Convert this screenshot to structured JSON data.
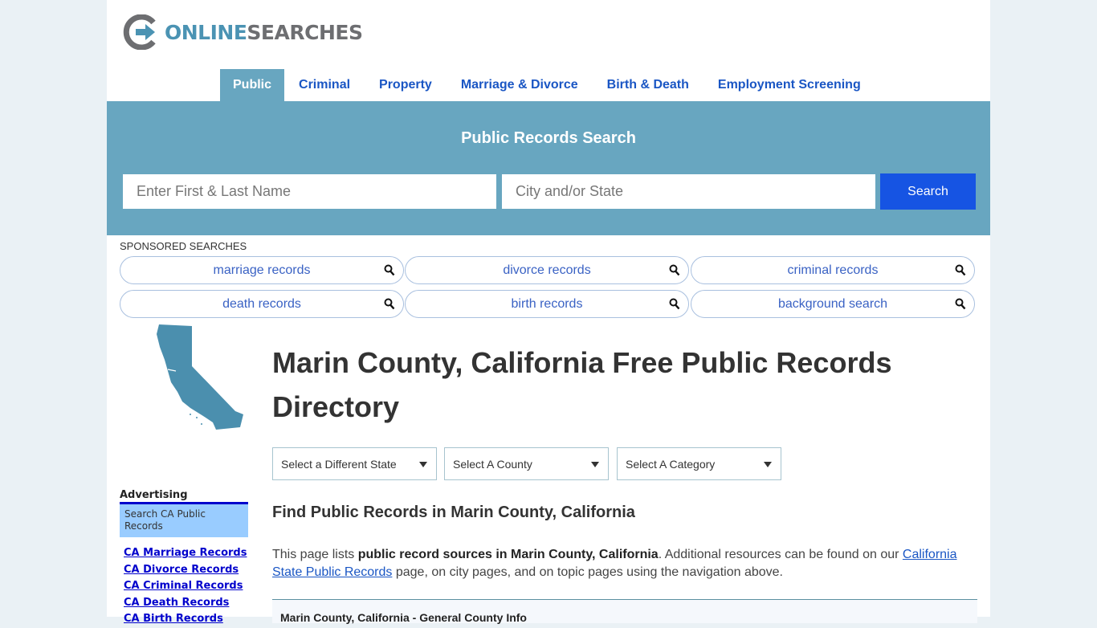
{
  "logo": {
    "part1": "ONLINE",
    "part2": "SEARCHES"
  },
  "nav": {
    "items": [
      {
        "label": "Public",
        "active": true
      },
      {
        "label": "Criminal"
      },
      {
        "label": "Property"
      },
      {
        "label": "Marriage & Divorce"
      },
      {
        "label": "Birth & Death"
      },
      {
        "label": "Employment Screening"
      }
    ]
  },
  "search": {
    "title": "Public Records Search",
    "name_placeholder": "Enter First & Last Name",
    "city_placeholder": "City and/or State",
    "button_label": "Search"
  },
  "sponsored": {
    "label": "SPONSORED SEARCHES",
    "items": [
      "marriage records",
      "divorce records",
      "criminal records",
      "death records",
      "birth records",
      "background search"
    ]
  },
  "sidebar": {
    "advertising_label": "Advertising",
    "ad_box": "Search CA Public Records",
    "links": [
      "CA Marriage Records",
      "CA Divorce Records",
      "CA Criminal Records",
      "CA Death Records",
      "CA Birth Records"
    ]
  },
  "main": {
    "title": "Marin County, California Free Public Records Directory",
    "selects": [
      "Select a Different State",
      "Select A County",
      "Select A Category"
    ],
    "subtitle": "Find Public Records in Marin County, California",
    "intro": {
      "pre": "This page lists ",
      "bold": "public record sources in Marin County, California",
      "mid": ". Additional resources can be found on our ",
      "link": "California State Public Records",
      "post": " page, on city pages, and on topic pages using the navigation above."
    },
    "info_box_title": "Marin County, California - General County Info"
  },
  "colors": {
    "accent": "#68a6c0",
    "button": "#1654e3",
    "link": "#1a56c4",
    "ad_box": "#99ccff"
  }
}
